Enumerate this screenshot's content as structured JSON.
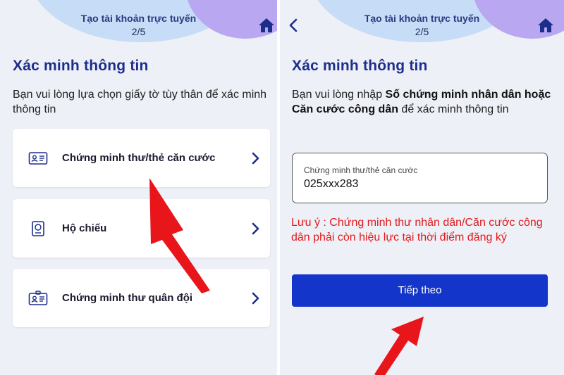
{
  "left_screen": {
    "header": {
      "title": "Tạo tài khoản trực tuyến",
      "step": "2/5",
      "home_icon": "home-icon"
    },
    "section_title": "Xác minh thông tin",
    "description": "Bạn vui lòng lựa chọn giấy tờ tùy thân để xác minh thông tin",
    "options": [
      {
        "label": "Chứng minh thư/thẻ căn cước",
        "icon": "id-card-icon"
      },
      {
        "label": "Hộ chiếu",
        "icon": "passport-icon"
      },
      {
        "label": "Chứng minh thư quân đội",
        "icon": "military-id-icon"
      }
    ]
  },
  "right_screen": {
    "header": {
      "title": "Tạo tài khoản trực tuyến",
      "step": "2/5",
      "home_icon": "home-icon",
      "back_icon": "chevron-left-icon"
    },
    "section_title": "Xác minh thông tin",
    "description": {
      "prefix": "Bạn vui lòng nhập ",
      "bold": "Số chứng minh nhân dân hoặc Căn cước công dân",
      "suffix": " để xác minh thông tin"
    },
    "id_field": {
      "label": "Chứng minh thư/thẻ căn cước",
      "value": "025xxx283"
    },
    "note": "Lưu ý : Chứng minh thư nhân dân/Căn cước công dân phải còn hiệu lực tại thời điểm đăng ký",
    "next_button": "Tiếp theo"
  },
  "colors": {
    "accent_blue": "#1435c9",
    "title_blue": "#1d2e8a",
    "warning_red": "#e11b1b",
    "annotation_arrow": "#e8151b",
    "background": "#eef0f7"
  }
}
